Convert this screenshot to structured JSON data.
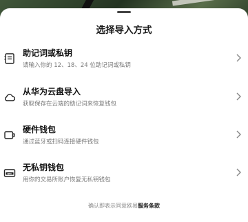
{
  "sheet": {
    "title": "选择导入方式"
  },
  "options": [
    {
      "icon": "mnemonic-icon",
      "title": "助记词或私钥",
      "desc": "请输入你的 12、18、24 位助记词或私钥"
    },
    {
      "icon": "cloud-icon",
      "title": "从华为云盘导入",
      "desc": "获取保存在云端的助记词来恢复钱包"
    },
    {
      "icon": "hardware-wallet-icon",
      "title": "硬件钱包",
      "desc": "通过蓝牙或扫码连接硬件钱包"
    },
    {
      "icon": "nfc-card-icon",
      "title": "无私钥钱包",
      "desc": "用你的交易所账户恢复无私钥钱包"
    }
  ],
  "footer": {
    "prefix": "确认即表示同意欧易",
    "link": "服务条款"
  }
}
